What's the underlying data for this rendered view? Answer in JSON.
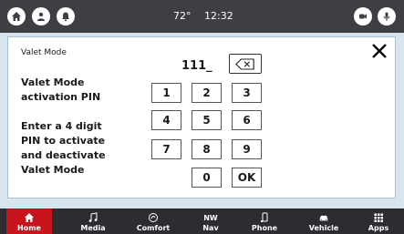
{
  "status": {
    "temperature": "72°",
    "time": "12:32",
    "left_icons": [
      "home-icon",
      "person-icon",
      "bell-icon"
    ],
    "right_icons": [
      "camera-icon",
      "microphone-icon"
    ]
  },
  "dialog": {
    "title": "Valet Mode",
    "label_activation": [
      "Valet Mode",
      "activation PIN"
    ],
    "label_instructions": [
      "Enter a 4 digit",
      "PIN to activate",
      "and deactivate",
      "Valet Mode"
    ],
    "pin_value": "111_",
    "backspace_icon": "backspace-icon",
    "close_icon": "close-icon",
    "keys": [
      "1",
      "2",
      "3",
      "4",
      "5",
      "6",
      "7",
      "8",
      "9",
      "0",
      "OK"
    ]
  },
  "nav": {
    "items": [
      {
        "label": "Home",
        "icon": "home-icon",
        "active": true
      },
      {
        "label": "Media",
        "icon": "music-icon",
        "active": false
      },
      {
        "label": "Comfort",
        "icon": "comfort-icon",
        "active": false
      },
      {
        "label": "Nav",
        "icon": "compass-icon",
        "active": false
      },
      {
        "label": "Phone",
        "icon": "phone-icon",
        "active": false
      },
      {
        "label": "Vehicle",
        "icon": "car-icon",
        "active": false
      },
      {
        "label": "Apps",
        "icon": "apps-icon",
        "active": false
      }
    ],
    "nav_compass_text": "NW",
    "colors": {
      "active": "#c7141d",
      "bar": "#2c2d30"
    }
  }
}
